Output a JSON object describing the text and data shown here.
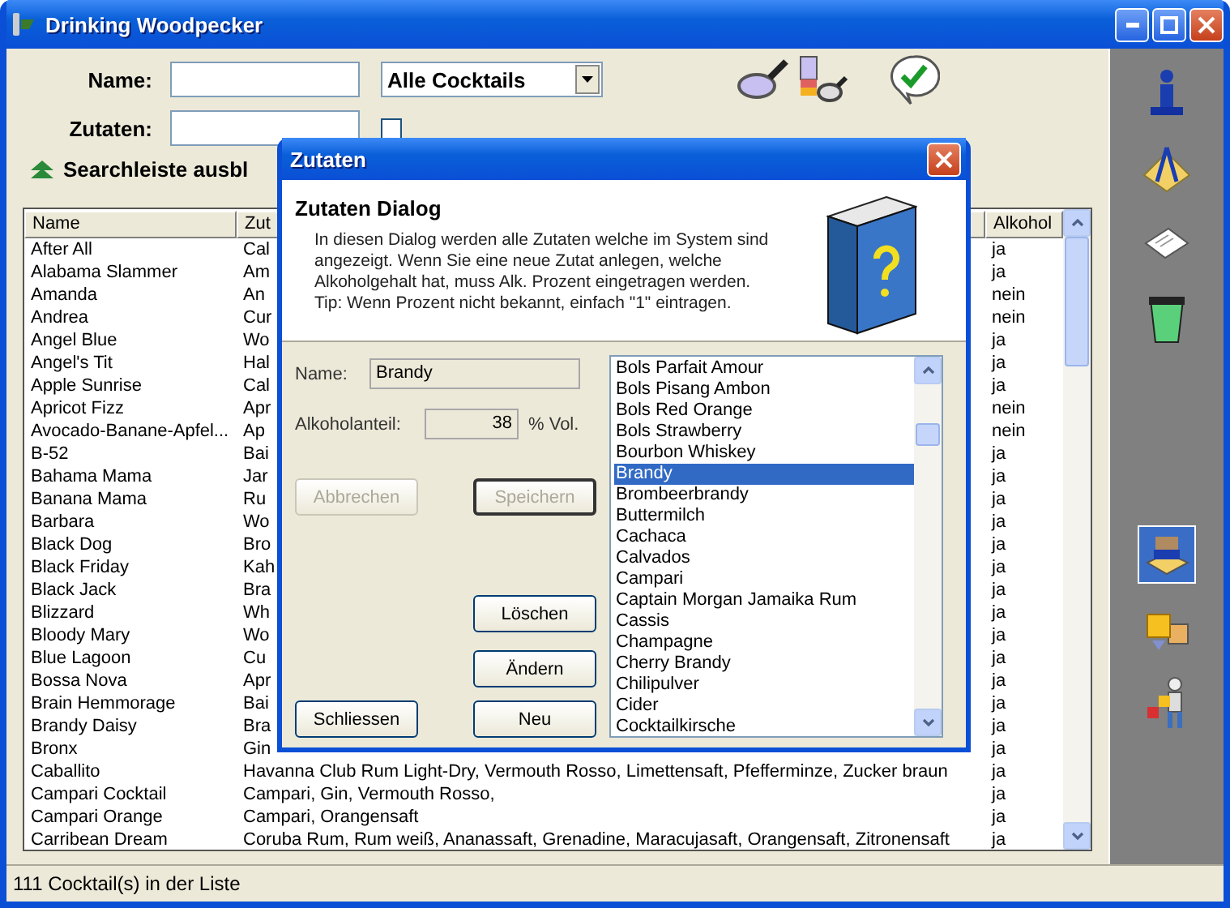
{
  "window": {
    "title": "Drinking Woodpecker"
  },
  "search": {
    "name_label": "Name:",
    "ingredients_label": "Zutaten:",
    "filter": "Alle Cocktails",
    "stock_checked": false,
    "toggle_label": "Searchleiste ausbl"
  },
  "table": {
    "columns": [
      "Name",
      "Zut",
      "Alkohol"
    ],
    "rows": [
      {
        "name": "After All",
        "ingredients": "Cal",
        "alcohol": "ja"
      },
      {
        "name": "Alabama Slammer",
        "ingredients": "Am",
        "alcohol": "ja"
      },
      {
        "name": "Amanda",
        "ingredients": "An",
        "alcohol": "nein"
      },
      {
        "name": "Andrea",
        "ingredients": "Cur",
        "alcohol": "nein"
      },
      {
        "name": "Angel Blue",
        "ingredients": "Wo",
        "alcohol": "ja"
      },
      {
        "name": "Angel's Tit",
        "ingredients": "Hal",
        "alcohol": "ja"
      },
      {
        "name": "Apple Sunrise",
        "ingredients": "Cal",
        "alcohol": "ja"
      },
      {
        "name": "Apricot Fizz",
        "ingredients": "Apr",
        "alcohol": "nein"
      },
      {
        "name": "Avocado-Banane-Apfel...",
        "ingredients": "Ap",
        "alcohol": "nein"
      },
      {
        "name": "B-52",
        "ingredients": "Bai",
        "alcohol": "ja"
      },
      {
        "name": "Bahama Mama",
        "ingredients": "Jar",
        "alcohol": "ja"
      },
      {
        "name": "Banana Mama",
        "ingredients": "Ru",
        "alcohol": "ja"
      },
      {
        "name": "Barbara",
        "ingredients": "Wo",
        "alcohol": "ja"
      },
      {
        "name": "Black Dog",
        "ingredients": "Bro",
        "alcohol": "ja"
      },
      {
        "name": "Black Friday",
        "ingredients": "Kah",
        "alcohol": "ja"
      },
      {
        "name": "Black Jack",
        "ingredients": "Bra",
        "alcohol": "ja"
      },
      {
        "name": "Blizzard",
        "ingredients": "Wh",
        "alcohol": "ja"
      },
      {
        "name": "Bloody Mary",
        "ingredients": "Wo",
        "alcohol": "ja"
      },
      {
        "name": "Blue Lagoon",
        "ingredients": "Cu",
        "alcohol": "ja"
      },
      {
        "name": "Bossa Nova",
        "ingredients": "Apr",
        "alcohol": "ja"
      },
      {
        "name": "Brain Hemmorage",
        "ingredients": "Bai",
        "alcohol": "ja"
      },
      {
        "name": "Brandy Daisy",
        "ingredients": "Bra",
        "alcohol": "ja"
      },
      {
        "name": "Bronx",
        "ingredients": "Gin",
        "alcohol": "ja"
      },
      {
        "name": "Caballito",
        "ingredients": "Havanna Club Rum Light-Dry, Vermouth Rosso, Limettensaft, Pfefferminze, Zucker braun",
        "alcohol": "ja"
      },
      {
        "name": "Campari Cocktail",
        "ingredients": "Campari, Gin, Vermouth Rosso,",
        "alcohol": "ja"
      },
      {
        "name": "Campari Orange",
        "ingredients": "Campari, Orangensaft",
        "alcohol": "ja"
      },
      {
        "name": "Carribean Dream",
        "ingredients": "Coruba Rum, Rum weiß, Ananassaft, Grenadine, Maracujasaft, Orangensaft, Zitronensaft",
        "alcohol": "ja"
      }
    ]
  },
  "sidebar": {
    "items": [
      {
        "kind": "info",
        "selected": false
      },
      {
        "kind": "compass",
        "selected": false
      },
      {
        "kind": "paper",
        "selected": false
      },
      {
        "kind": "bin",
        "selected": false
      },
      {
        "kind": "books",
        "selected": true
      },
      {
        "kind": "cubes",
        "selected": false
      },
      {
        "kind": "worker",
        "selected": false
      }
    ]
  },
  "status_bar": "111 Cocktail(s) in der Liste",
  "dialog": {
    "title": "Zutaten",
    "heading": "Zutaten Dialog",
    "description": [
      "In diesen Dialog werden alle Zutaten welche im System sind",
      "angezeigt. Wenn Sie eine neue Zutat anlegen, welche",
      "Alkoholgehalt hat, muss Alk. Prozent eingetragen werden.",
      "Tip: Wenn Prozent nicht bekannt, einfach \"1\" eintragen."
    ],
    "name_label": "Name:",
    "name_value": "Brandy",
    "alcohol_label": "Alkoholanteil:",
    "alcohol_value": "38",
    "alcohol_unit": "% Vol.",
    "edit_buttons": [
      {
        "label": "Abbrechen",
        "disabled": true,
        "default": false
      },
      {
        "label": "Speichern",
        "disabled": true,
        "default": true
      }
    ],
    "action_buttons": [
      {
        "label": "Löschen",
        "disabled": false,
        "default": false
      },
      {
        "label": "Ändern",
        "disabled": false,
        "default": false
      }
    ],
    "footer_buttons": [
      {
        "label": "Schliessen",
        "disabled": false,
        "default": false
      },
      {
        "label": "Neu",
        "disabled": false,
        "default": false
      }
    ],
    "ingredients": [
      {
        "label": "Bols Parfait Amour",
        "selected": false
      },
      {
        "label": "Bols Pisang Ambon",
        "selected": false
      },
      {
        "label": "Bols Red Orange",
        "selected": false
      },
      {
        "label": "Bols Strawberry",
        "selected": false
      },
      {
        "label": "Bourbon Whiskey",
        "selected": false
      },
      {
        "label": "Brandy",
        "selected": true
      },
      {
        "label": "Brombeerbrandy",
        "selected": false
      },
      {
        "label": "Buttermilch",
        "selected": false
      },
      {
        "label": "Cachaca",
        "selected": false
      },
      {
        "label": "Calvados",
        "selected": false
      },
      {
        "label": "Campari",
        "selected": false
      },
      {
        "label": "Captain Morgan Jamaika Rum",
        "selected": false
      },
      {
        "label": "Cassis",
        "selected": false
      },
      {
        "label": "Champagne",
        "selected": false
      },
      {
        "label": "Cherry Brandy",
        "selected": false
      },
      {
        "label": "Chilipulver",
        "selected": false
      },
      {
        "label": "Cider",
        "selected": false
      },
      {
        "label": "Cocktailkirsche",
        "selected": false
      }
    ]
  }
}
